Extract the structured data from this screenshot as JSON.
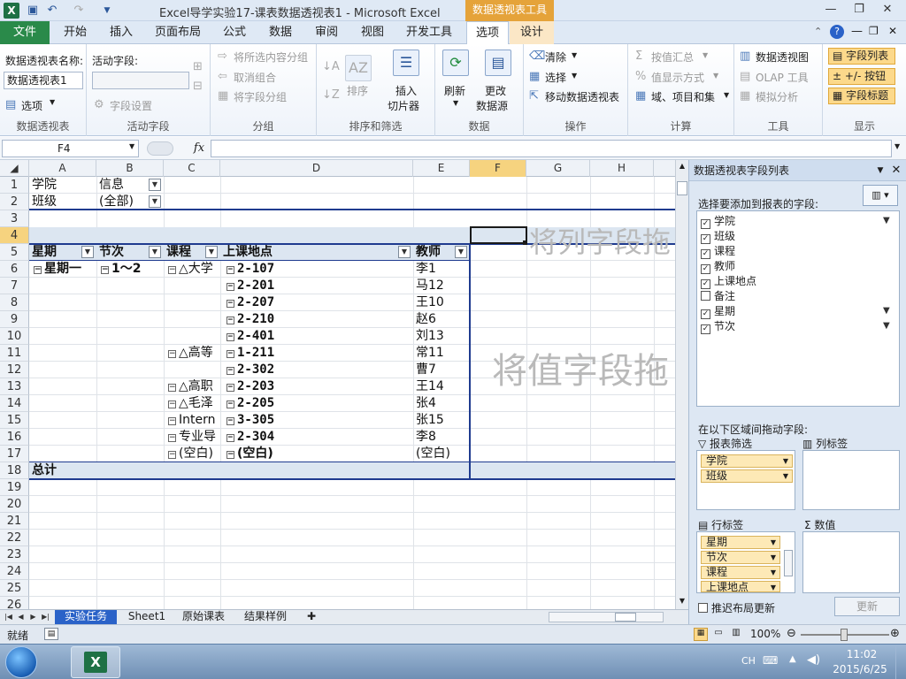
{
  "window": {
    "title": "Excel导学实验17-课表数据透视表1 - Microsoft Excel",
    "context_title": "数据透视表工具",
    "app_icon": "X"
  },
  "tabs": {
    "file": "文件",
    "items": [
      "开始",
      "插入",
      "页面布局",
      "公式",
      "数据",
      "审阅",
      "视图",
      "开发工具",
      "选项",
      "设计"
    ]
  },
  "ribbon": {
    "pivot_group": {
      "name_label": "数据透视表名称:",
      "name_value": "数据透视表1",
      "options": "选项",
      "label": "数据透视表"
    },
    "active_field_group": {
      "label_title": "活动字段:",
      "field_settings": "字段设置",
      "label": "活动字段"
    },
    "group_group": {
      "group_selection": "将所选内容分组",
      "ungroup": "取消组合",
      "group_field": "将字段分组",
      "label": "分组"
    },
    "sort_group": {
      "sort": "排序",
      "slicer1": "插入",
      "slicer2": "切片器",
      "label": "排序和筛选"
    },
    "data_group": {
      "refresh": "刷新",
      "change1": "更改",
      "change2": "数据源",
      "label": "数据"
    },
    "actions_group": {
      "clear": "清除",
      "select": "选择",
      "move": "移动数据透视表",
      "label": "操作"
    },
    "calc_group": {
      "summarize": "按值汇总",
      "show_as": "值显示方式",
      "fields_items": "域、项目和集",
      "label": "计算"
    },
    "tools_group": {
      "pivotchart": "数据透视图",
      "olap": "OLAP 工具",
      "whatif": "模拟分析",
      "label": "工具"
    },
    "show_group": {
      "field_list": "字段列表",
      "buttons": "+/- 按钮",
      "headers": "字段标题",
      "label": "显示"
    }
  },
  "formula_bar": {
    "name_box": "F4",
    "fx": "fx"
  },
  "grid": {
    "columns": [
      "A",
      "B",
      "C",
      "D",
      "E",
      "F",
      "G",
      "H"
    ],
    "rows": [
      "1",
      "2",
      "3",
      "4",
      "5",
      "6",
      "7",
      "8",
      "9",
      "10",
      "11",
      "12",
      "13",
      "14",
      "15",
      "16",
      "17",
      "18",
      "19",
      "20",
      "21",
      "22",
      "23",
      "24",
      "25",
      "26"
    ],
    "filters": [
      {
        "field": "学院",
        "value": "信息"
      },
      {
        "field": "班级",
        "value": "(全部)"
      }
    ],
    "headers": [
      "星期",
      "节次",
      "课程",
      "上课地点",
      "教师"
    ],
    "body": {
      "day": "星期一",
      "period": "1～2",
      "courses": [
        "△大学",
        "△高等",
        "△高职",
        "△毛泽",
        "Intern",
        "专业导",
        "(空白)"
      ],
      "locations": [
        "2-107",
        "2-201",
        "2-207",
        "2-210",
        "2-401",
        "1-211",
        "2-302",
        "2-203",
        "2-205",
        "3-305",
        "2-304",
        "(空白)"
      ],
      "teachers": [
        "李1",
        "马12",
        "王10",
        "赵6",
        "刘13",
        "常11",
        "曹7",
        "王14",
        "张4",
        "张15",
        "李8",
        "(空白)"
      ]
    },
    "total": "总计",
    "watermark_cols": "将列字段拖",
    "watermark_vals": "将值字段拖"
  },
  "sheets": [
    "实验任务",
    "Sheet1",
    "原始课表",
    "结果样例"
  ],
  "status": {
    "ready": "就绪",
    "zoom": "100%"
  },
  "taskbar": {
    "lang": "CH",
    "time": "11:02",
    "date": "2015/6/25"
  },
  "pane": {
    "title": "数据透视表字段列表",
    "prompt": "选择要添加到报表的字段:",
    "fields": [
      {
        "name": "学院",
        "checked": true,
        "filtered": true
      },
      {
        "name": "班级",
        "checked": true,
        "filtered": false
      },
      {
        "name": "课程",
        "checked": true,
        "filtered": false
      },
      {
        "name": "教师",
        "checked": true,
        "filtered": false
      },
      {
        "name": "上课地点",
        "checked": true,
        "filtered": false
      },
      {
        "name": "备注",
        "checked": false,
        "filtered": false
      },
      {
        "name": "星期",
        "checked": true,
        "filtered": true
      },
      {
        "name": "节次",
        "checked": true,
        "filtered": true
      }
    ],
    "drag_prompt": "在以下区域间拖动字段:",
    "report_filter": "报表筛选",
    "column_labels": "列标签",
    "row_labels": "行标签",
    "values": "数值",
    "filter_chips": [
      "学院",
      "班级"
    ],
    "row_chips": [
      "星期",
      "节次",
      "课程",
      "上课地点"
    ],
    "defer": "推迟布局更新",
    "update": "更新"
  }
}
